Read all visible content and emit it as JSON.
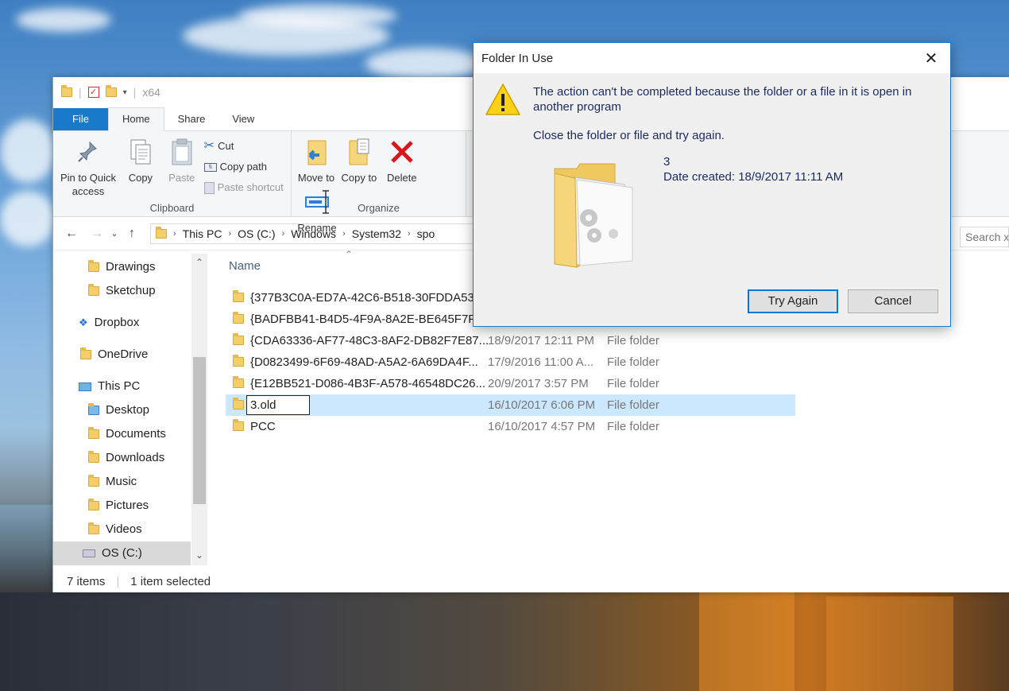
{
  "window": {
    "title": "x64",
    "tabs": {
      "file": "File",
      "home": "Home",
      "share": "Share",
      "view": "View"
    }
  },
  "ribbon": {
    "clipboard": {
      "pin": "Pin to Quick access",
      "copy": "Copy",
      "paste": "Paste",
      "cut": "Cut",
      "copy_path": "Copy path",
      "paste_shortcut": "Paste shortcut",
      "label": "Clipboard"
    },
    "organize": {
      "move_to": "Move to",
      "copy_to": "Copy to",
      "delete": "Delete",
      "rename": "Rename",
      "label": "Organize"
    }
  },
  "address": {
    "crumbs": [
      "This PC",
      "OS (C:)",
      "Windows",
      "System32",
      "spo"
    ],
    "search_placeholder": "Search x"
  },
  "nav": {
    "items": [
      {
        "label": "Drawings",
        "icon": "folder-icon"
      },
      {
        "label": "Sketchup",
        "icon": "folder-icon"
      },
      {
        "label": "Dropbox",
        "icon": "dropbox-icon"
      },
      {
        "label": "OneDrive",
        "icon": "folder-icon"
      },
      {
        "label": "This PC",
        "icon": "pc-icon"
      },
      {
        "label": "Desktop",
        "icon": "folder-icon"
      },
      {
        "label": "Documents",
        "icon": "documents-icon"
      },
      {
        "label": "Downloads",
        "icon": "downloads-icon"
      },
      {
        "label": "Music",
        "icon": "music-icon"
      },
      {
        "label": "Pictures",
        "icon": "pictures-icon"
      },
      {
        "label": "Videos",
        "icon": "videos-icon"
      },
      {
        "label": "OS (C:)",
        "icon": "drive-icon"
      }
    ]
  },
  "list": {
    "column_name": "Name",
    "rows": [
      {
        "name": "{377B3C0A-ED7A-42C6-B518-30FDDA53...",
        "date": "",
        "type": ""
      },
      {
        "name": "{BADFBB41-B4D5-4F9A-8A2E-BE645F7F...",
        "date": "",
        "type": ""
      },
      {
        "name": "{CDA63336-AF77-48C3-8AF2-DB82F7E87...",
        "date": "18/9/2017 12:11 PM",
        "type": "File folder"
      },
      {
        "name": "{D0823499-6F69-48AD-A5A2-6A69DA4F...",
        "date": "17/9/2016 11:00 A...",
        "type": "File folder"
      },
      {
        "name": "{E12BB521-D086-4B3F-A578-46548DC26...",
        "date": "20/9/2017 3:57 PM",
        "type": "File folder"
      },
      {
        "name": "3.old",
        "date": "16/10/2017 6:06 PM",
        "type": "File folder"
      },
      {
        "name": "PCC",
        "date": "16/10/2017 4:57 PM",
        "type": "File folder"
      }
    ]
  },
  "status": {
    "count": "7 items",
    "selected": "1 item selected"
  },
  "dialog": {
    "title": "Folder In Use",
    "message": "The action can't be completed because the folder or a file in it is open in another program",
    "instruction": "Close the folder or file and try again.",
    "item_name": "3",
    "item_date": "Date created: 18/9/2017 11:11 AM",
    "try_again": "Try Again",
    "cancel": "Cancel"
  }
}
